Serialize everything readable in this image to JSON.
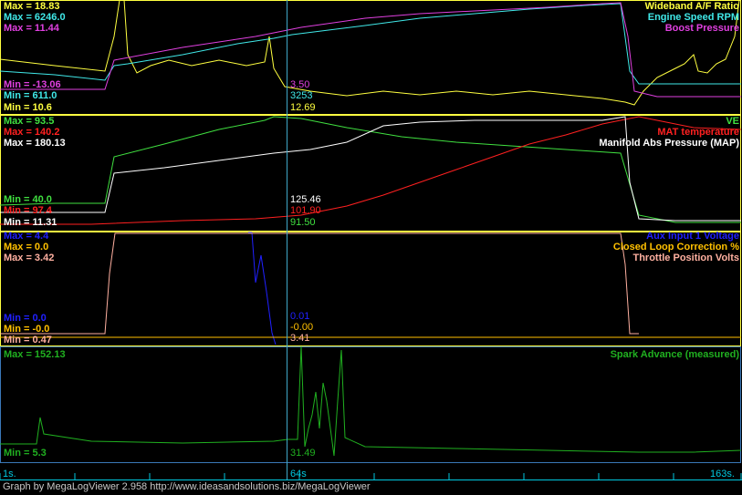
{
  "credit": "Graph by MegaLogViewer 2.958 http://www.ideasandsolutions.biz/MegaLogViewer",
  "colors": {
    "background": "#000000",
    "panel_border_yellow": "#ffff40",
    "panel_border_blue": "#3a78b8",
    "cursor_line": "#3fa8c8",
    "time_axis": "#00c8e0",
    "yellow": "#ffff40",
    "cyan": "#40e8e8",
    "magenta": "#e040e0",
    "green": "#40e040",
    "red": "#ff2020",
    "white": "#ffffff",
    "blue": "#2020ff",
    "orange": "#ffc000",
    "pink": "#ffb0a0",
    "dkgreen": "#20b020"
  },
  "cursor_time": 64,
  "time_axis": {
    "start_label": "1s.",
    "cursor_label": "64s",
    "end_label": "163s."
  },
  "chart_data": [
    {
      "type": "line",
      "panel": 1,
      "x_range": [
        1,
        163
      ],
      "series": [
        {
          "name": "Wideband A/F Ratio",
          "color": "yellow",
          "max_label": "Max = 18.83",
          "min_label": "Min = 10.6",
          "cursor_value": "12.69"
        },
        {
          "name": "Engine Speed RPM",
          "color": "cyan",
          "max_label": "Max = 6246.0",
          "min_label": "Min = 611.0",
          "cursor_value": "3253"
        },
        {
          "name": "Boost Pressure",
          "color": "magenta",
          "max_label": "Max = 11.44",
          "min_label": "Min = -13.06",
          "cursor_value": "3.50"
        }
      ]
    },
    {
      "type": "line",
      "panel": 2,
      "x_range": [
        1,
        163
      ],
      "series": [
        {
          "name": "VE",
          "color": "green",
          "max_label": "Max = 93.5",
          "min_label": "Min = 40.0",
          "cursor_value": "91.50"
        },
        {
          "name": "MAT temperature",
          "color": "red",
          "max_label": "Max = 140.2",
          "min_label": "Min = 97.4",
          "cursor_value": "101.90"
        },
        {
          "name": "Manifold Abs Pressure (MAP)",
          "color": "white",
          "max_label": "Max = 180.13",
          "min_label": "Min = 11.31",
          "cursor_value": "125.46"
        }
      ]
    },
    {
      "type": "line",
      "panel": 3,
      "x_range": [
        1,
        163
      ],
      "series": [
        {
          "name": "Aux Input 1 Voltage",
          "color": "blue",
          "max_label": "Max = 4.4",
          "min_label": "Min = 0.0",
          "cursor_value": "0.01"
        },
        {
          "name": "Closed Loop Correction %",
          "color": "orange",
          "max_label": "Max = 0.0",
          "min_label": "Min = -0.0",
          "cursor_value": "-0.00"
        },
        {
          "name": "Throttle Position Volts",
          "color": "pink",
          "max_label": "Max = 3.42",
          "min_label": "Min = 0.47",
          "cursor_value": "3.41"
        }
      ]
    },
    {
      "type": "line",
      "panel": 4,
      "x_range": [
        1,
        163
      ],
      "series": [
        {
          "name": "Spark Advance (measured)",
          "color": "dkgreen",
          "max_label": "Max = 152.13",
          "min_label": "Min = 5.3",
          "cursor_value": "31.49"
        }
      ]
    }
  ]
}
